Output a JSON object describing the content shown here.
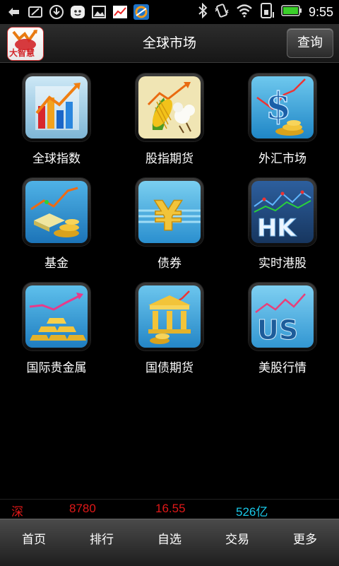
{
  "status_bar": {
    "time": "9:55",
    "icons": [
      "usb-debug-icon",
      "sd-card-icon",
      "download-icon",
      "messenger-icon",
      "gallery-icon",
      "stock-app-icon",
      "weather-app-icon",
      "bluetooth-icon",
      "vibrate-icon",
      "wifi-icon",
      "sim-icon",
      "battery-icon"
    ]
  },
  "header": {
    "logo_text": "大智慧",
    "title": "全球市场",
    "query_label": "查询"
  },
  "grid": {
    "items": [
      {
        "label": "全球指数",
        "icon": "bar-chart-icon"
      },
      {
        "label": "股指期货",
        "icon": "corn-cotton-icon"
      },
      {
        "label": "外汇市场",
        "icon": "dollar-coins-icon"
      },
      {
        "label": "基金",
        "icon": "gold-bars-coins-icon"
      },
      {
        "label": "债券",
        "icon": "yen-icon"
      },
      {
        "label": "实时港股",
        "icon": "hk-icon"
      },
      {
        "label": "国际贵金属",
        "icon": "gold-ingots-icon"
      },
      {
        "label": "国债期货",
        "icon": "government-building-icon"
      },
      {
        "label": "美股行情",
        "icon": "us-icon"
      }
    ]
  },
  "ticker": {
    "market": "深",
    "index": "8780",
    "change": "16.55",
    "volume": "526亿",
    "colors": {
      "red": "#e01818",
      "cyan": "#19c8e8"
    }
  },
  "bottom_nav": {
    "items": [
      "首页",
      "排行",
      "自选",
      "交易",
      "更多"
    ]
  }
}
